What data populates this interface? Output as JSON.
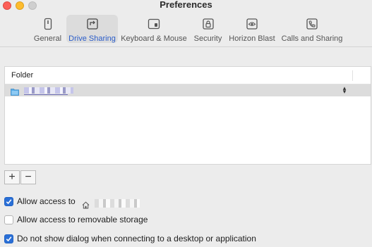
{
  "window": {
    "title": "Preferences"
  },
  "toolbar": {
    "tabs": [
      {
        "label": "General",
        "icon": "phone-device-icon",
        "selected": false
      },
      {
        "label": "Drive Sharing",
        "icon": "folder-share-icon",
        "selected": true
      },
      {
        "label": "Keyboard & Mouse",
        "icon": "keyboard-mouse-icon",
        "selected": false
      },
      {
        "label": "Security",
        "icon": "lock-icon",
        "selected": false
      },
      {
        "label": "Horizon Blast",
        "icon": "cloud-eye-icon",
        "selected": false
      },
      {
        "label": "Calls and Sharing",
        "icon": "phone-call-icon",
        "selected": false
      }
    ]
  },
  "table": {
    "column_header": "Folder",
    "rows": [
      {
        "icon": "folder-icon"
      }
    ]
  },
  "buttons": {
    "add_label": "+",
    "remove_label": "−"
  },
  "options": {
    "allow_access": {
      "label": "Allow access to",
      "checked": true,
      "icon": "home-icon"
    },
    "removable_storage": {
      "label": "Allow access to removable storage",
      "checked": false
    },
    "no_dialog": {
      "label": "Do not show dialog when connecting to a desktop or application",
      "checked": true
    }
  },
  "colors": {
    "accent": "#2a6fd6",
    "selected_tab_text": "#2a5cc9",
    "close": "#fc5f57",
    "minimize": "#fdbc2e"
  }
}
